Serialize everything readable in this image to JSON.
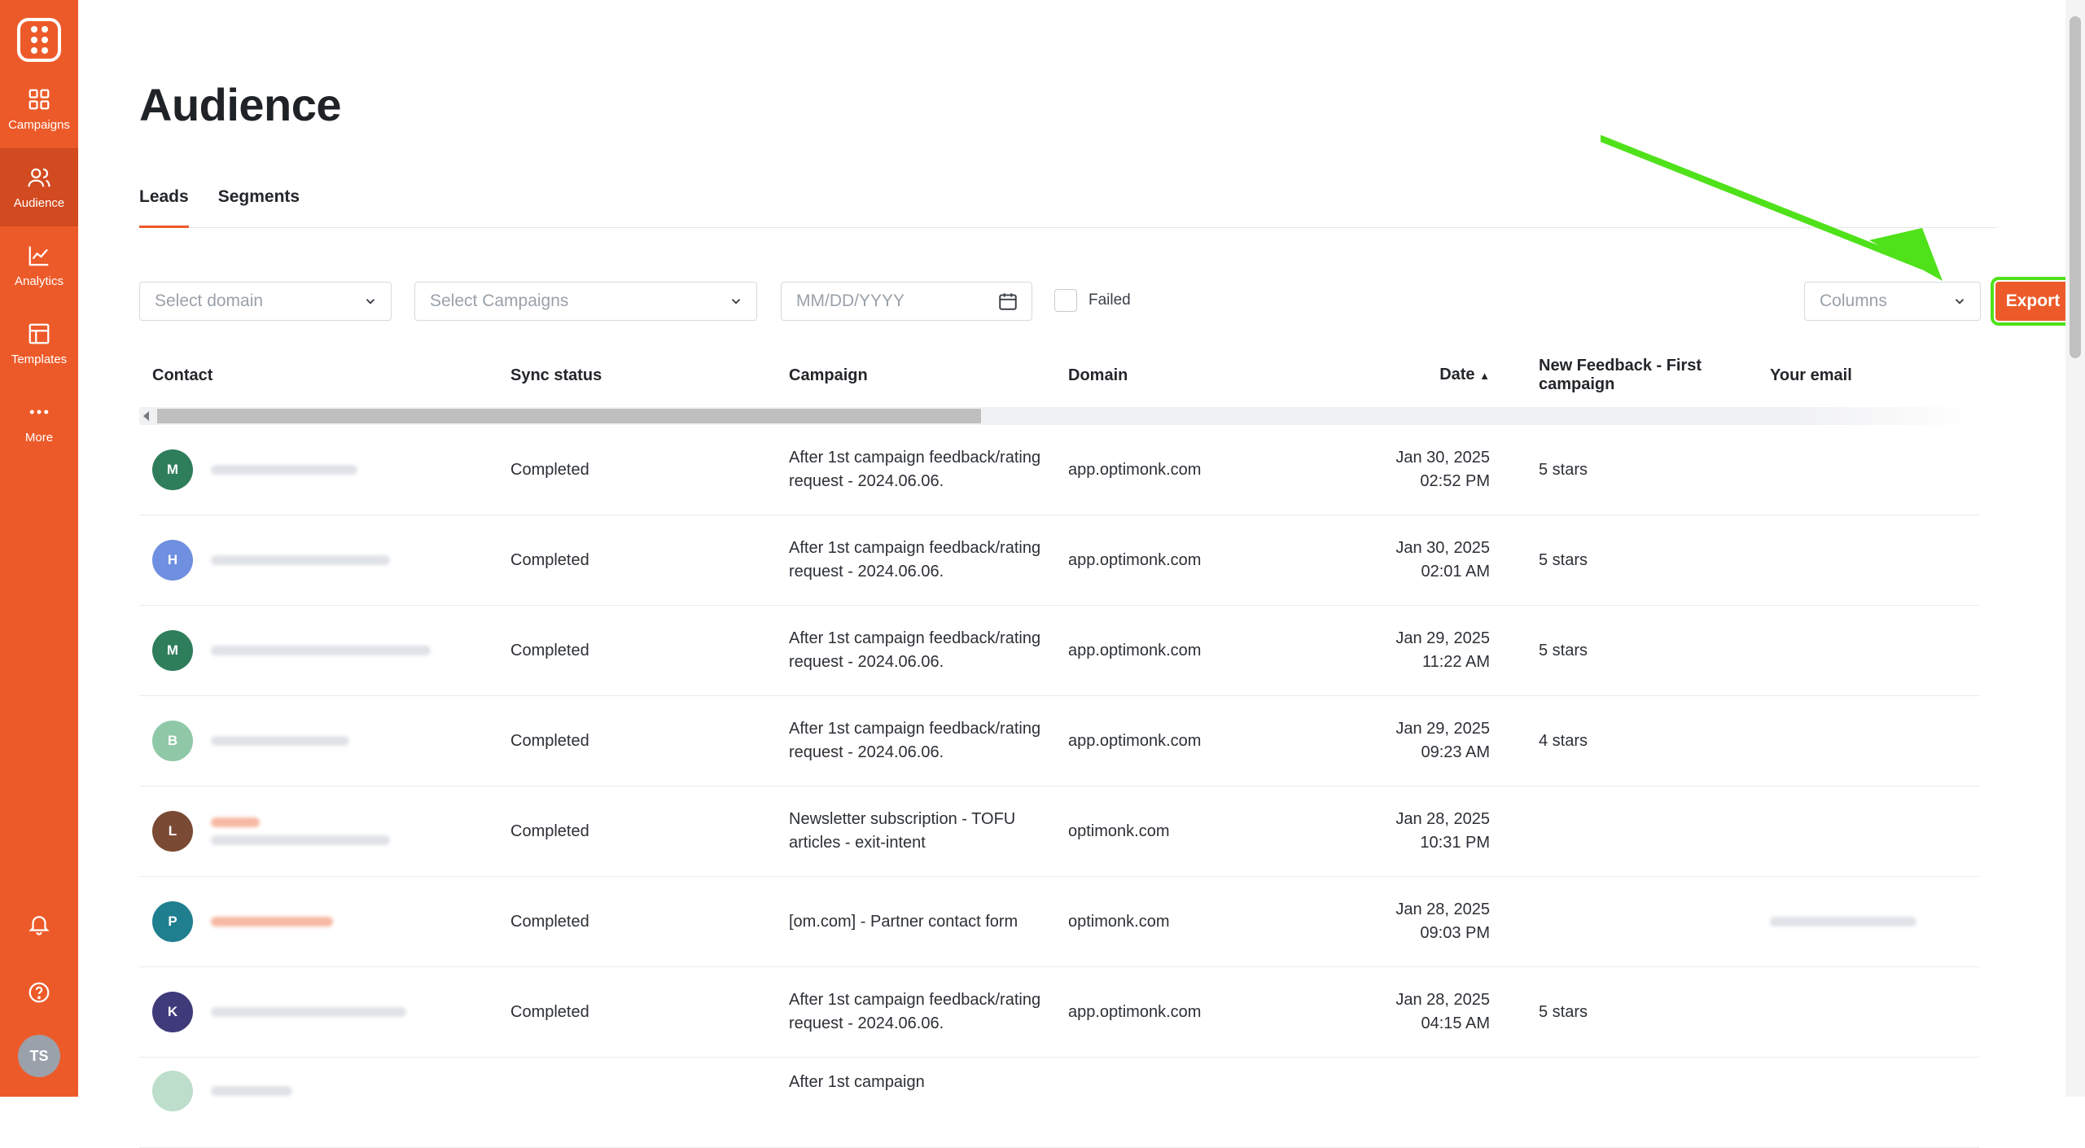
{
  "sidebar": {
    "items": [
      {
        "label": "Campaigns",
        "icon": "grid-icon"
      },
      {
        "label": "Audience",
        "icon": "users-icon",
        "active": true
      },
      {
        "label": "Analytics",
        "icon": "chart-line-icon"
      },
      {
        "label": "Templates",
        "icon": "layout-icon"
      },
      {
        "label": "More",
        "icon": "dots-icon"
      }
    ],
    "bottom": {
      "notifications_icon": "bell-icon",
      "help_icon": "help-icon",
      "user_initials": "TS"
    }
  },
  "page": {
    "title": "Audience"
  },
  "tabs": [
    {
      "label": "Leads",
      "active": true
    },
    {
      "label": "Segments"
    }
  ],
  "filters": {
    "domain_placeholder": "Select domain",
    "campaigns_placeholder": "Select Campaigns",
    "date_placeholder": "MM/DD/YYYY",
    "failed_label": "Failed",
    "columns_placeholder": "Columns",
    "export_label": "Export"
  },
  "table": {
    "headers": {
      "contact": "Contact",
      "sync": "Sync status",
      "campaign": "Campaign",
      "domain": "Domain",
      "date": "Date",
      "feedback": "New Feedback - First campaign",
      "email": "Your email"
    },
    "rows": [
      {
        "initial": "M",
        "avatar_color": "#2e7d5b",
        "sync": "Completed",
        "campaign": "After 1st campaign feedback/rating request - 2024.06.06.",
        "domain": "app.optimonk.com",
        "date": "Jan 30, 2025",
        "time": "02:52 PM",
        "feedback": "5 stars"
      },
      {
        "initial": "H",
        "avatar_color": "#6f8fe0",
        "sync": "Completed",
        "campaign": "After 1st campaign feedback/rating request - 2024.06.06.",
        "domain": "app.optimonk.com",
        "date": "Jan 30, 2025",
        "time": "02:01 AM",
        "feedback": "5 stars"
      },
      {
        "initial": "M",
        "avatar_color": "#2e7d5b",
        "sync": "Completed",
        "campaign": "After 1st campaign feedback/rating request - 2024.06.06.",
        "domain": "app.optimonk.com",
        "date": "Jan 29, 2025",
        "time": "11:22 AM",
        "feedback": "5 stars"
      },
      {
        "initial": "B",
        "avatar_color": "#8fc8a7",
        "sync": "Completed",
        "campaign": "After 1st campaign feedback/rating request - 2024.06.06.",
        "domain": "app.optimonk.com",
        "date": "Jan 29, 2025",
        "time": "09:23 AM",
        "feedback": "4 stars"
      },
      {
        "initial": "L",
        "avatar_color": "#7a4a35",
        "sync": "Completed",
        "campaign": "Newsletter subscription - TOFU articles - exit-intent",
        "domain": "optimonk.com",
        "date": "Jan 28, 2025",
        "time": "10:31 PM",
        "feedback": ""
      },
      {
        "initial": "P",
        "avatar_color": "#1f7f8f",
        "sync": "Completed",
        "campaign": "[om.com] - Partner contact form",
        "domain": "optimonk.com",
        "date": "Jan 28, 2025",
        "time": "09:03 PM",
        "feedback": ""
      },
      {
        "initial": "K",
        "avatar_color": "#3f3a7a",
        "sync": "Completed",
        "campaign": "After 1st campaign feedback/rating request - 2024.06.06.",
        "domain": "app.optimonk.com",
        "date": "Jan 28, 2025",
        "time": "04:15 AM",
        "feedback": "5 stars"
      },
      {
        "initial": "",
        "avatar_color": "#8fc8a7",
        "sync": "",
        "campaign": "After 1st campaign",
        "domain": "",
        "date": "",
        "time": "",
        "feedback": ""
      }
    ]
  },
  "colors": {
    "brand": "#ed5a29",
    "highlight_arrow": "#4fe11a"
  }
}
